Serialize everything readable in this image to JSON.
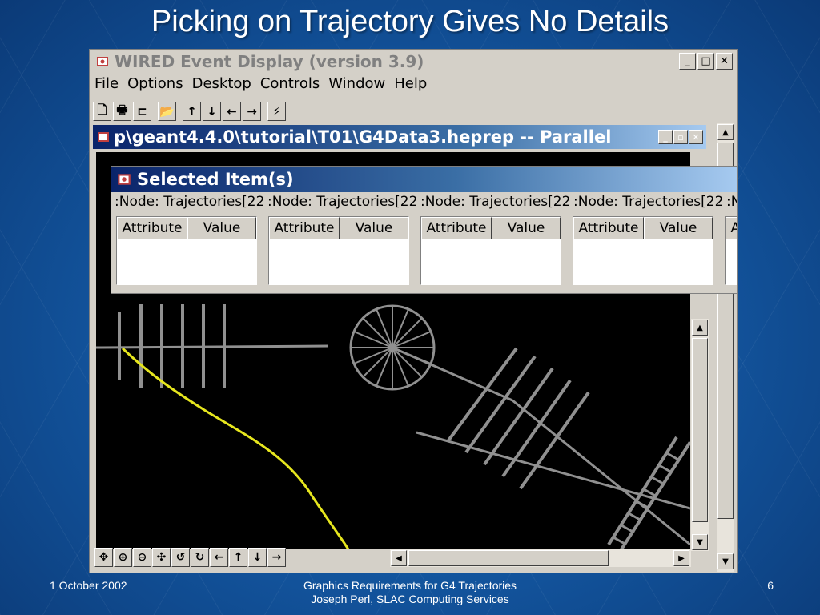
{
  "slide": {
    "title": "Picking on Trajectory Gives No Details",
    "footer_left": "1 October 2002",
    "footer_center_line1": "Graphics Requirements for G4 Trajectories",
    "footer_center_line2": "Joseph Perl, SLAC Computing Services",
    "page_number": "6"
  },
  "app": {
    "title": "WIRED Event Display (version 3.9)",
    "window_buttons": [
      "_",
      "□",
      "✕"
    ],
    "menu": [
      "File",
      "Options",
      "Desktop",
      "Controls",
      "Window",
      "Help"
    ],
    "toolbar_icons": [
      "new-icon",
      "print-icon",
      "tree-icon",
      "open-folder-icon",
      "arrow-up-icon",
      "arrow-down-icon",
      "arrow-left-icon",
      "arrow-right-icon",
      "wand-icon"
    ],
    "toolbar_glyphs": [
      "🗋",
      "🖶",
      "⊏",
      "📂",
      "↑",
      "↓",
      "←",
      "→",
      "⚡"
    ]
  },
  "inner_window": {
    "title": "p\\geant4.4.0\\tutorial\\T01\\G4Data3.heprep -- Parallel",
    "buttons": [
      "_",
      "▫",
      "✕"
    ]
  },
  "selected_dialog": {
    "title": "Selected Item(s)",
    "tabs": [
      ":Node: Trajectories[22",
      ":Node: Trajectories[22",
      ":Node: Trajectories[22",
      ":Node: Trajectories[22",
      ":N"
    ],
    "columns": {
      "attribute": "Attribute",
      "value": "Value"
    }
  },
  "bottom_toolbar": {
    "icons": [
      "move-icon",
      "zoom-in-icon",
      "zoom-out-icon",
      "pan-icon",
      "rotate-left-icon",
      "rotate-right-icon",
      "arrow-left-icon",
      "arrow-up-icon",
      "arrow-down-icon",
      "arrow-right-icon"
    ],
    "glyphs": [
      "✥",
      "⊕",
      "⊖",
      "✣",
      "↺",
      "↻",
      "←",
      "↑",
      "↓",
      "→"
    ]
  },
  "colors": {
    "background": "#12529a",
    "window": "#d4d0c8",
    "title_gradient_start": "#0a246a",
    "trajectory_picked": "#e6e61e",
    "detector": "#909090"
  }
}
